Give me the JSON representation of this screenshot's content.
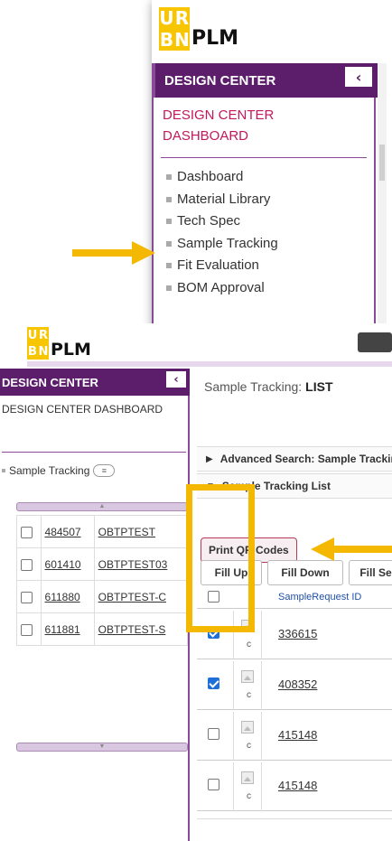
{
  "logo": {
    "letters": [
      "U",
      "R",
      "B",
      "N"
    ],
    "plm": "PLM"
  },
  "panel1": {
    "header": "DESIGN CENTER",
    "collapse": "‹",
    "dashboard_link": "DESIGN CENTER DASHBOARD",
    "menu": [
      "Dashboard",
      "Material Library",
      "Tech Spec",
      "Sample Tracking",
      "Fit Evaluation",
      "BOM Approval"
    ]
  },
  "panel2": {
    "header": "DESIGN CENTER",
    "collapse": "‹",
    "dashboard_text": "DESIGN CENTER DASHBOARD",
    "sidebar_item": "Sample Tracking",
    "sidebar_rows": [
      {
        "id": "484507",
        "name": "OBTPTEST"
      },
      {
        "id": "601410",
        "name": "OBTPTEST03"
      },
      {
        "id": "611880",
        "name": "OBTPTEST-C"
      },
      {
        "id": "611881",
        "name": "OBTPTEST-S"
      }
    ],
    "page_title": "Sample Tracking:",
    "page_mode": "LIST",
    "advanced_search": "Advanced Search: Sample Tracking",
    "list_section": "Sample Tracking List",
    "print_qr": "Print QR Codes",
    "fill_up": "Fill Up",
    "fill_down": "Fill Down",
    "fill_select": "Fill Se",
    "col_header": "SampleRequest ID",
    "rows": [
      {
        "id": "336615",
        "checked": true,
        "mark": "c"
      },
      {
        "id": "408352",
        "checked": true,
        "mark": "c"
      },
      {
        "id": "415148",
        "checked": false,
        "mark": "c"
      },
      {
        "id": "415148",
        "checked": false,
        "mark": "c"
      }
    ]
  },
  "colors": {
    "purple": "#5c1d6b",
    "accent_pink": "#c2185b",
    "highlight": "#f5b800",
    "logo_yellow": "#f7c600"
  }
}
